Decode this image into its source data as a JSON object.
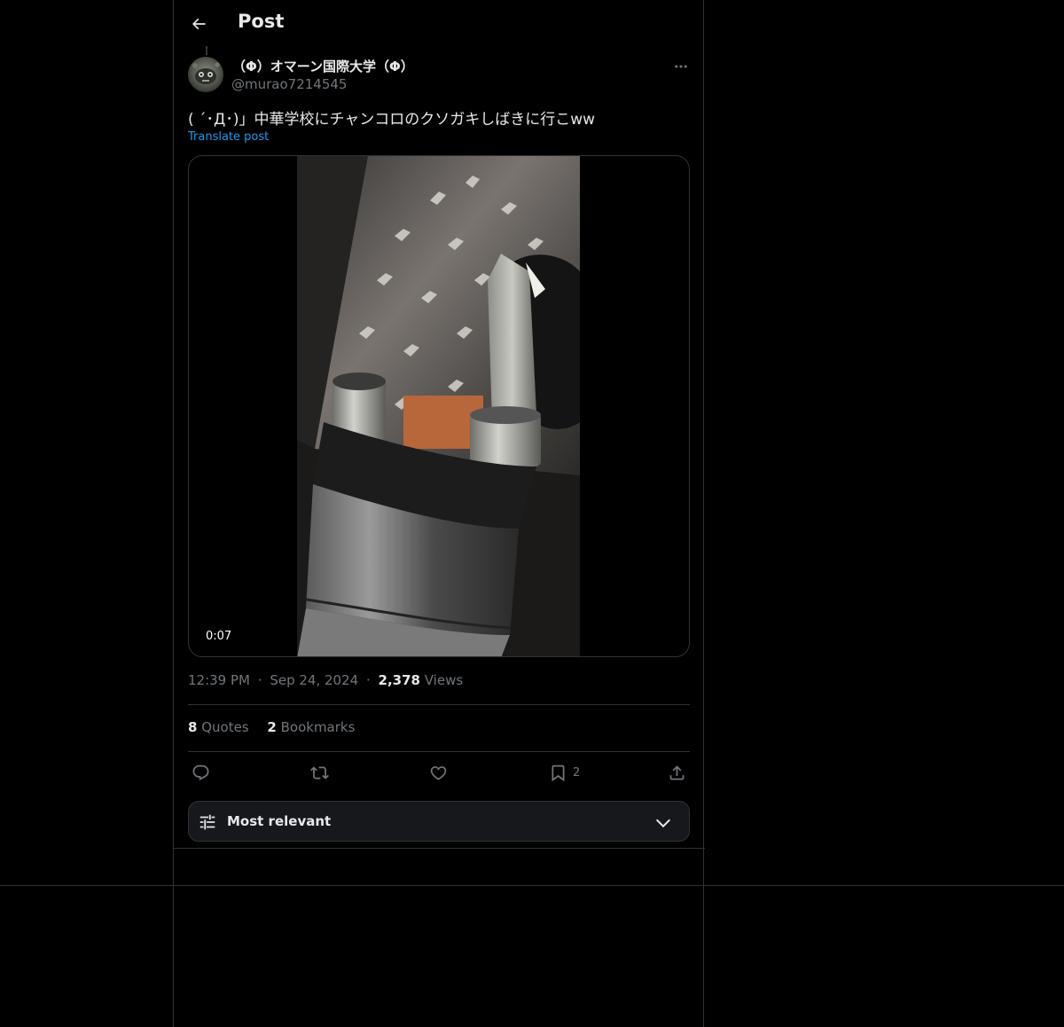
{
  "header": {
    "title": "Post"
  },
  "author": {
    "display_name": "（Φ）オマーン国際大学（Φ）",
    "handle": "@murao7214545"
  },
  "post": {
    "text": "( ´･Д･)」中華学校にチャンコロのクソガキしばきに行こww",
    "translate_label": "Translate post"
  },
  "media": {
    "duration": "0:07"
  },
  "meta": {
    "time": "12:39 PM",
    "dot": "·",
    "date": "Sep 24, 2024",
    "views_count": "2,378",
    "views_label": " Views"
  },
  "stats": {
    "quotes_count": "8",
    "quotes_label": " Quotes",
    "bookmarks_count": "2",
    "bookmarks_label": " Bookmarks"
  },
  "actions": {
    "bookmark_count": "2"
  },
  "sort": {
    "label": "Most relevant"
  },
  "colors": {
    "background": "#000000",
    "border": "#2f3336",
    "text_primary": "#e7e9ea",
    "text_secondary": "#71767b",
    "accent": "#1d9bf0"
  }
}
